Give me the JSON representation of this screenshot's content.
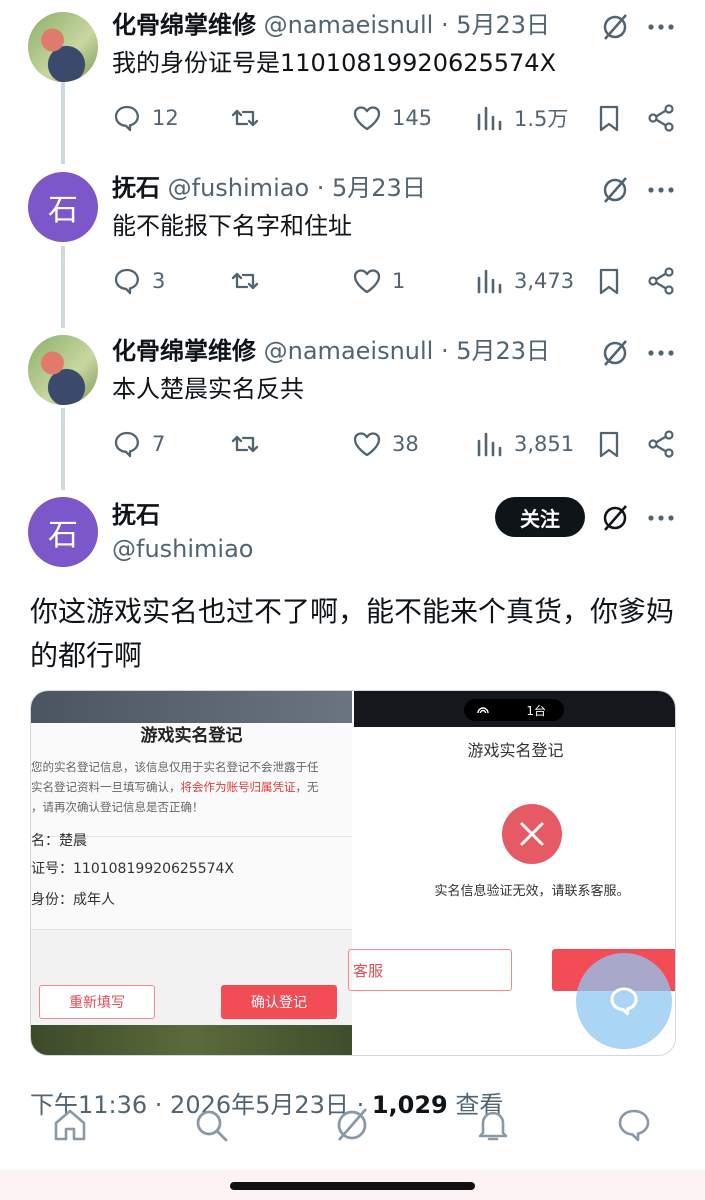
{
  "replies": [
    {
      "name": "化骨绵掌维修",
      "handle": "@namaeisnull · 5月23日",
      "text": "我的身份证号是11010819920625574X",
      "replies": "12",
      "likes": "145",
      "views": "1.5万"
    },
    {
      "avatar_letter": "石",
      "name": "抚石",
      "handle": "@fushimiao · 5月23日",
      "text": "能不能报下名字和住址",
      "replies": "3",
      "likes": "1",
      "views": "3,473"
    },
    {
      "name": "化骨绵掌维修",
      "handle": "@namaeisnull · 5月23日",
      "text": "本人楚晨实名反共",
      "replies": "7",
      "likes": "38",
      "views": "3,851"
    }
  ],
  "main_post": {
    "avatar_letter": "石",
    "name": "抚石",
    "handle": "@fushimiao",
    "follow_label": "关注",
    "text": "你这游戏实名也过不了啊，能不能来个真货，你爹妈的都行啊",
    "timestamp": "下午11:36 · 2026年5月23日 · ",
    "view_count": "1,029",
    "view_label": " 查看"
  },
  "media_left": {
    "title": "游戏实名登记",
    "notice_line1": "您的实名登记信息，该信息仅用于实名登记不会泄露于任",
    "notice_line2a": "实名登记资料一旦填写确认，",
    "notice_line2b": "将会作为账号归属凭证",
    "notice_line2c": "，无",
    "notice_line3": "，请再次确认登记信息是否正确！",
    "name_row": "名：楚晨",
    "id_row": "证号：11010819920625574X",
    "identity_row": "身份：成年人",
    "refill_button": "重新填写",
    "confirm_button": "确认登记"
  },
  "media_right": {
    "status_pill": "1台",
    "title": "游戏实名登记",
    "message": "实名信息验证无效，请联系客服。",
    "service_button": "客服"
  },
  "colors": {
    "accent_red": "#f24d57",
    "avatar_purple": "#7b57c9",
    "follow_bg": "#0f1419",
    "secondary_text": "#536471",
    "fab_blue": "#8ec7f0"
  }
}
